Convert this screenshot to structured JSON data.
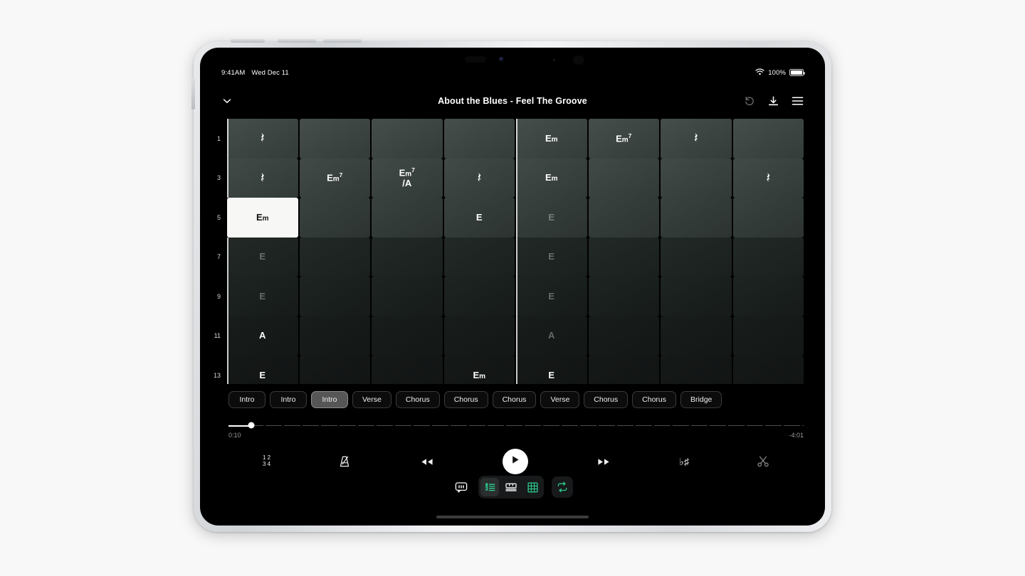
{
  "status": {
    "time": "9:41AM",
    "date": "Wed Dec 11",
    "battery_pct": "100%",
    "wifi_icon": "wifi-icon",
    "battery_icon": "battery-icon"
  },
  "header": {
    "title": "About the Blues - Feel The Groove",
    "collapse_icon": "chevron-down-icon",
    "undo_icon": "undo-icon",
    "download_icon": "download-icon",
    "menu_icon": "hamburger-menu-icon"
  },
  "chart_data": {
    "type": "table",
    "title": "Chord chart grid",
    "columns": 8,
    "row_labels": [
      "1",
      "3",
      "5",
      "7",
      "9",
      "11",
      "13"
    ],
    "rows": [
      {
        "label": "1",
        "dim": false,
        "cells": [
          {
            "text": "rest",
            "type": "rest",
            "barline": true
          },
          {
            "text": "",
            "type": "empty",
            "barline": false
          },
          {
            "text": "",
            "type": "empty",
            "barline": false
          },
          {
            "text": "",
            "type": "empty",
            "barline": false
          },
          {
            "text": "Em",
            "type": "chord",
            "root": "E",
            "quality": "m",
            "barline": true
          },
          {
            "text": "Em7",
            "type": "chord",
            "root": "E",
            "quality": "m",
            "ext": "7",
            "barline": false
          },
          {
            "text": "rest",
            "type": "rest",
            "barline": false
          },
          {
            "text": "",
            "type": "empty",
            "barline": false
          }
        ]
      },
      {
        "label": "3",
        "dim": false,
        "cells": [
          {
            "text": "rest",
            "type": "rest",
            "barline": true
          },
          {
            "text": "Em7",
            "type": "chord",
            "root": "E",
            "quality": "m",
            "ext": "7",
            "barline": false
          },
          {
            "text": "Em7/A",
            "type": "slash",
            "root": "E",
            "quality": "m",
            "ext": "7",
            "bass": "A",
            "barline": false
          },
          {
            "text": "rest",
            "type": "rest",
            "barline": false
          },
          {
            "text": "Em",
            "type": "chord",
            "root": "E",
            "quality": "m",
            "barline": true
          },
          {
            "text": "",
            "type": "empty",
            "barline": false
          },
          {
            "text": "",
            "type": "empty",
            "barline": false
          },
          {
            "text": "rest",
            "type": "rest",
            "barline": false
          }
        ]
      },
      {
        "label": "5",
        "dim": false,
        "cells": [
          {
            "text": "Em",
            "type": "chord",
            "root": "E",
            "quality": "m",
            "barline": false,
            "selected": true
          },
          {
            "text": "",
            "type": "empty",
            "barline": false
          },
          {
            "text": "",
            "type": "empty",
            "barline": false
          },
          {
            "text": "E",
            "type": "chord",
            "root": "E",
            "barline": false
          },
          {
            "text": "E",
            "type": "chord",
            "root": "E",
            "barline": true,
            "faded": true
          },
          {
            "text": "",
            "type": "empty",
            "barline": false
          },
          {
            "text": "",
            "type": "empty",
            "barline": false
          },
          {
            "text": "",
            "type": "empty",
            "barline": false
          }
        ]
      },
      {
        "label": "7",
        "dim": true,
        "cells": [
          {
            "text": "E",
            "type": "chord",
            "root": "E",
            "barline": true
          },
          {
            "text": "",
            "type": "empty",
            "barline": false
          },
          {
            "text": "",
            "type": "empty",
            "barline": false
          },
          {
            "text": "",
            "type": "empty",
            "barline": false
          },
          {
            "text": "E",
            "type": "chord",
            "root": "E",
            "barline": true
          },
          {
            "text": "",
            "type": "empty",
            "barline": false
          },
          {
            "text": "",
            "type": "empty",
            "barline": false
          },
          {
            "text": "",
            "type": "empty",
            "barline": false
          }
        ]
      },
      {
        "label": "9",
        "dim": true,
        "cells": [
          {
            "text": "E",
            "type": "chord",
            "root": "E",
            "barline": true
          },
          {
            "text": "",
            "type": "empty",
            "barline": false
          },
          {
            "text": "",
            "type": "empty",
            "barline": false
          },
          {
            "text": "",
            "type": "empty",
            "barline": false
          },
          {
            "text": "E",
            "type": "chord",
            "root": "E",
            "barline": true
          },
          {
            "text": "",
            "type": "empty",
            "barline": false
          },
          {
            "text": "",
            "type": "empty",
            "barline": false
          },
          {
            "text": "",
            "type": "empty",
            "barline": false
          }
        ]
      },
      {
        "label": "11",
        "dim": false,
        "cells": [
          {
            "text": "A",
            "type": "chord",
            "root": "A",
            "barline": true
          },
          {
            "text": "",
            "type": "empty",
            "barline": false
          },
          {
            "text": "",
            "type": "empty",
            "barline": false
          },
          {
            "text": "",
            "type": "empty",
            "barline": false
          },
          {
            "text": "A",
            "type": "chord",
            "root": "A",
            "barline": true,
            "faded": true
          },
          {
            "text": "",
            "type": "empty",
            "barline": false
          },
          {
            "text": "",
            "type": "empty",
            "barline": false
          },
          {
            "text": "",
            "type": "empty",
            "barline": false
          }
        ]
      },
      {
        "label": "13",
        "dim": false,
        "cells": [
          {
            "text": "E",
            "type": "chord",
            "root": "E",
            "barline": true
          },
          {
            "text": "",
            "type": "empty",
            "barline": false
          },
          {
            "text": "",
            "type": "empty",
            "barline": false
          },
          {
            "text": "Em",
            "type": "chord",
            "root": "E",
            "quality": "m",
            "barline": false
          },
          {
            "text": "E",
            "type": "chord",
            "root": "E",
            "barline": true
          },
          {
            "text": "",
            "type": "empty",
            "barline": false
          },
          {
            "text": "",
            "type": "empty",
            "barline": false
          },
          {
            "text": "",
            "type": "empty",
            "barline": false
          }
        ]
      }
    ]
  },
  "sections": {
    "active_index": 2,
    "chips": [
      "Intro",
      "Intro",
      "Intro",
      "Verse",
      "Chorus",
      "Chorus",
      "Chorus",
      "Verse",
      "Chorus",
      "Chorus",
      "Bridge"
    ]
  },
  "scrubber": {
    "elapsed": "0:10",
    "remaining": "-4:01",
    "progress_pct": 4
  },
  "transport": {
    "count_in_top": "1 2",
    "count_in_bottom": "3 4",
    "count_in_icon": "count-in-icon",
    "metronome_icon": "metronome-icon",
    "rewind_icon": "rewind-icon",
    "play_icon": "play-icon",
    "forward_icon": "fast-forward-icon",
    "key_signature": "♭♯",
    "key_icon": "transpose-icon",
    "scissors_icon": "scissors-icon"
  },
  "bottom_toolbar": {
    "lyrics_icon": "lyrics-icon",
    "notation_icon": "notation-staff-icon",
    "keyboard_icon": "piano-keyboard-icon",
    "grid_icon": "chord-grid-icon",
    "loop_icon": "loop-icon",
    "active_view_index": 0,
    "accent_color": "#2ecc8f"
  }
}
